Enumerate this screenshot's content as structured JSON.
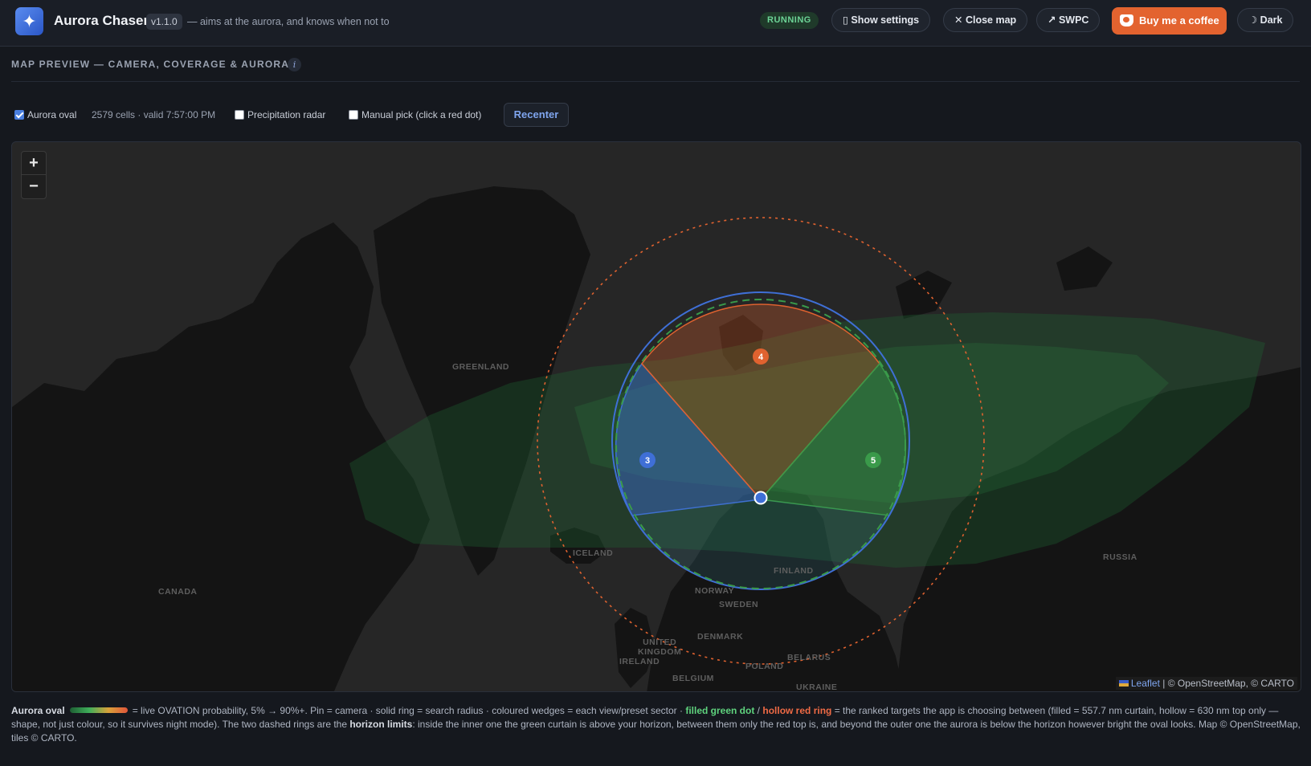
{
  "header": {
    "logo_glyph": "✦",
    "title": "Aurora Chaser",
    "version": "v1.1.0",
    "tagline": "— aims at the aurora, and knows when not to",
    "status": "RUNNING",
    "buttons": {
      "settings": "▯ Show settings",
      "close_map": "✕ Close map",
      "swpc": "↗ SWPC",
      "coffee": "Buy me a coffee",
      "theme": "☽ Dark"
    }
  },
  "section": {
    "title": "MAP PREVIEW — CAMERA, COVERAGE & AURORA",
    "info": "i"
  },
  "controls": {
    "aurora_oval": "Aurora oval",
    "cells_info": "2579 cells · valid 7:57:00 PM",
    "precipitation": "Precipitation radar",
    "manual_pick": "Manual pick (click a red dot)",
    "recenter": "Recenter"
  },
  "map": {
    "zoom_in": "+",
    "zoom_out": "−",
    "labels": {
      "greenland": "GREENLAND",
      "canada": "CANADA",
      "iceland": "ICELAND",
      "norway": "NORWAY",
      "sweden": "SWEDEN",
      "finland": "FINLAND",
      "russia": "RUSSIA",
      "denmark": "DENMARK",
      "united_kingdom": "UNITED\nKINGDOM",
      "ireland": "IRELAND",
      "belgium": "BELGIUM",
      "poland": "POLAND",
      "belarus": "BELARUS",
      "ukraine": "UKRAINE"
    },
    "wedges": [
      {
        "number": "3",
        "color": "#3f6fd6"
      },
      {
        "number": "4",
        "color": "#e0622f"
      },
      {
        "number": "5",
        "color": "#3a9a4a"
      }
    ],
    "attribution_link": "Leaflet",
    "attribution_text": " | © OpenStreetMap, © CARTO"
  },
  "legend": {
    "label": "Aurora oval",
    "t1": "= live OVATION probability, 5% → 90%+. Pin = camera · solid ring = search radius · coloured wedges = each view/preset sector · ",
    "green": "filled green dot",
    "sep": " / ",
    "red": "hollow red ring",
    "t2": " = the ranked targets the app is choosing between (filled = 557.7 nm curtain, hollow = 630 nm top only — shape, not just colour, so it survives night mode). The two dashed rings are the ",
    "horizon": "horizon limits",
    "t3": ": inside the inner one the green curtain is above your horizon, between them only the red top is, and beyond the outer one the aurora is below the horizon however bright the oval looks. Map © OpenStreetMap, tiles © CARTO."
  }
}
